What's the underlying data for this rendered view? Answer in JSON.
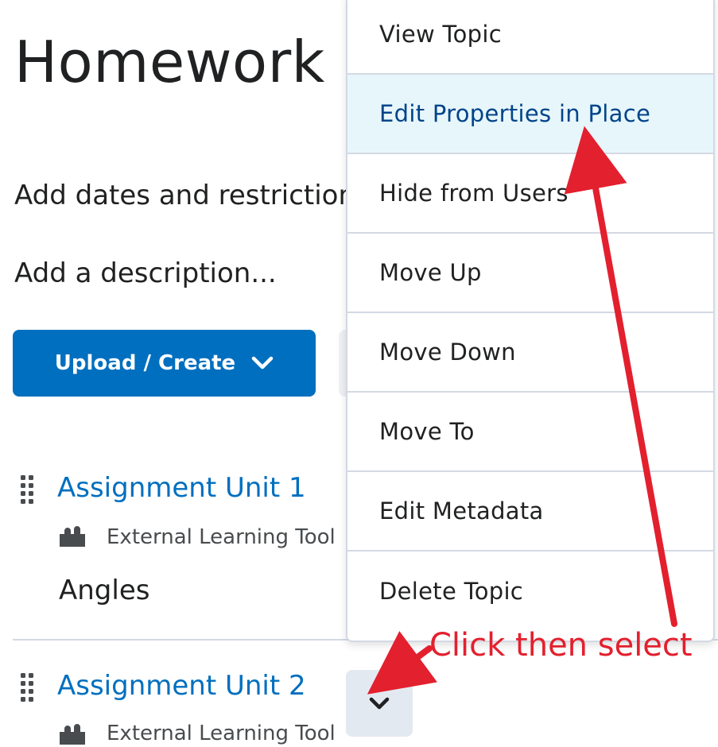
{
  "page": {
    "title": "Homework"
  },
  "module": {
    "add_dates_label": "Add dates and restrictions...",
    "add_description_label": "Add a description..."
  },
  "toolbar": {
    "upload_create_label": "Upload / Create"
  },
  "items": [
    {
      "title": "Assignment Unit 1",
      "type": "External Learning Tool",
      "description": "Angles"
    },
    {
      "title": "Assignment Unit 2",
      "type": "External Learning Tool"
    }
  ],
  "context_menu": {
    "items": [
      {
        "label": "View Topic"
      },
      {
        "label": "Edit Properties in Place",
        "highlighted": true
      },
      {
        "label": "Hide from Users"
      },
      {
        "label": "Move Up"
      },
      {
        "label": "Move Down"
      },
      {
        "label": "Move To"
      },
      {
        "label": "Edit Metadata"
      },
      {
        "label": "Delete Topic"
      }
    ]
  },
  "annotation": {
    "text": "Click then select",
    "color": "#e3202e"
  },
  "colors": {
    "accent": "#006fbf",
    "menu_highlight_bg": "#e7f6fb",
    "menu_highlight_text": "#004489"
  },
  "icons": {
    "drag": "drag-handle-icon",
    "tool": "puzzle-icon",
    "chevron": "chevron-down-icon"
  }
}
